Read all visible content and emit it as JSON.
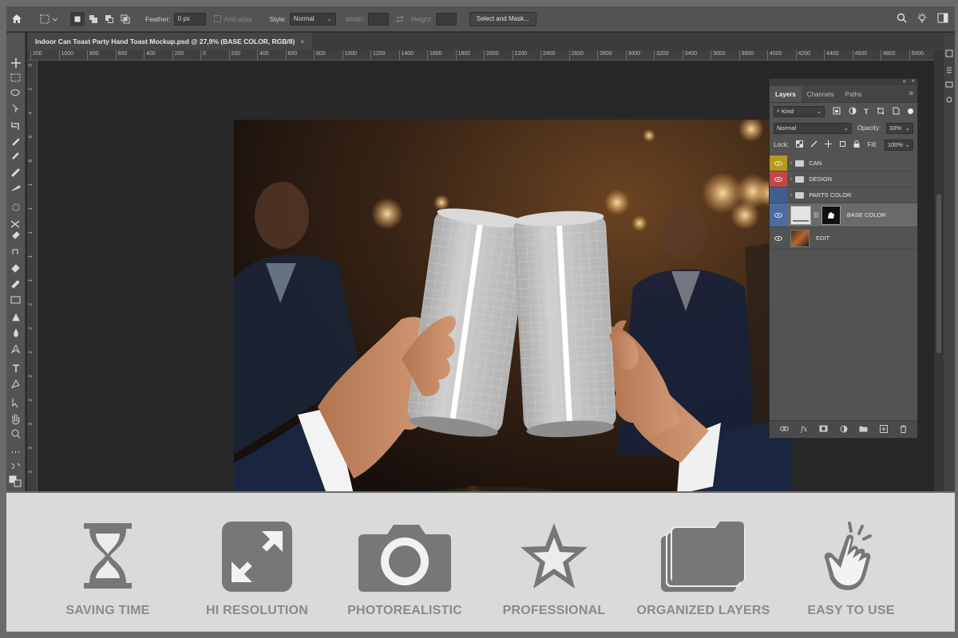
{
  "options_bar": {
    "feather_label": "Feather:",
    "feather_value": "0 px",
    "anti_alias_label": "Anti-alias",
    "style_label": "Style:",
    "style_value": "Normal",
    "width_label": "Width:",
    "height_label": "Height:",
    "select_mask_label": "Select and Mask..."
  },
  "document": {
    "tab_title": "Indoor Can Toast Party Hand Toast Mockup.psd @ 27,9% (BASE COLOR, RGB/8)",
    "close_glyph": "×"
  },
  "ruler": {
    "h_ticks": [
      "200",
      "1000",
      "800",
      "600",
      "400",
      "200",
      "0",
      "200",
      "400",
      "600",
      "800",
      "1000",
      "1200",
      "1400",
      "1600",
      "1800",
      "2000",
      "2200",
      "2400",
      "2600",
      "2800",
      "3000",
      "3200",
      "3400",
      "3600",
      "3800",
      "4000",
      "4200",
      "4400",
      "4600",
      "4800",
      "5000"
    ],
    "v_ticks": [
      "0",
      "2",
      "4",
      "6",
      "8",
      "1",
      "1",
      "1",
      "1",
      "1",
      "2",
      "2",
      "2",
      "2",
      "2",
      "3",
      "3",
      "3"
    ]
  },
  "layers_panel": {
    "tabs": [
      "Layers",
      "Channels",
      "Paths"
    ],
    "kind_label": "Kind",
    "blend_mode": "Normal",
    "opacity_label": "Opacity:",
    "opacity_value": "33%",
    "lock_label": "Lock:",
    "fill_label": "Fill:",
    "fill_value": "100%",
    "layers": [
      {
        "name": "CAN",
        "color": "#b79a1c",
        "type": "group"
      },
      {
        "name": "DESIGN",
        "color": "#c24747",
        "type": "group"
      },
      {
        "name": "PARTS COLOR",
        "color": "#3f5f94",
        "type": "group"
      },
      {
        "name": "BASE COLOR",
        "color": "#4c6a9e",
        "type": "layer",
        "selected": true
      },
      {
        "name": "EDIT",
        "color": "",
        "type": "smart"
      }
    ]
  },
  "features": [
    {
      "label": "SAVING TIME",
      "icon": "hourglass-icon"
    },
    {
      "label": "HI RESOLUTION",
      "icon": "expand-icon"
    },
    {
      "label": "PHOTOREALISTIC",
      "icon": "camera-icon"
    },
    {
      "label": "PROFESSIONAL",
      "icon": "star-icon"
    },
    {
      "label": "ORGANIZED LAYERS",
      "icon": "layers-icon"
    },
    {
      "label": "EASY TO USE",
      "icon": "tap-hand-icon"
    }
  ],
  "colors": {
    "app_bg": "#2b2b2b",
    "panel_bg": "#535353",
    "strip_bg": "#dadada",
    "icon_gray": "#777777",
    "label_gray": "#8a8a8a"
  }
}
